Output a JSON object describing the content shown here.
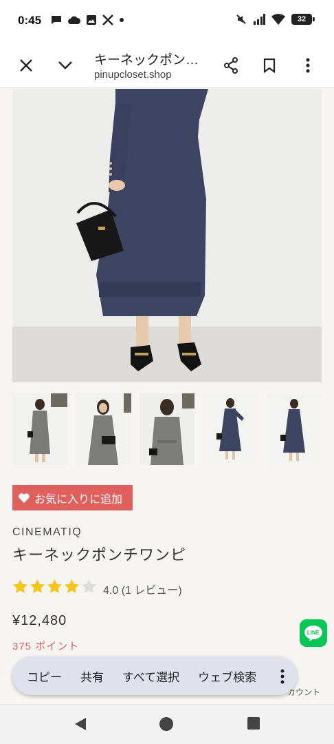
{
  "status_bar": {
    "time": "0:45",
    "battery": "32",
    "left_icons": [
      "chat-bubble-icon",
      "cloud-icon",
      "image-icon",
      "x-logo-icon",
      "dot-icon"
    ],
    "right_icons": [
      "mute-icon",
      "signal-icon",
      "wifi-icon",
      "battery-icon"
    ]
  },
  "toolbar": {
    "title": "キーネックポン…",
    "url": "pinupcloset.shop",
    "icons": [
      "close-icon",
      "chevron-down-icon",
      "share-icon",
      "bookmark-icon",
      "more-vert-icon"
    ]
  },
  "product": {
    "favorite_label": "お気に入りに追加",
    "brand": "CINEMATIQ",
    "name": "キーネックポンチワンピ",
    "rating": 4.0,
    "rating_text": "4.0 (1 レビュー)",
    "price": "¥12,480",
    "points": "375 ポイント"
  },
  "thumbnails_count": 5,
  "side": {
    "account_text": "カウント",
    "line_label": "LINE"
  },
  "context_menu": {
    "items": [
      "コピー",
      "共有",
      "すべて選択",
      "ウェブ検索"
    ]
  },
  "colors": {
    "accent": "#e0605e",
    "dress": "#3e4563",
    "line_green": "#06c755",
    "star": "#f5c51e"
  }
}
